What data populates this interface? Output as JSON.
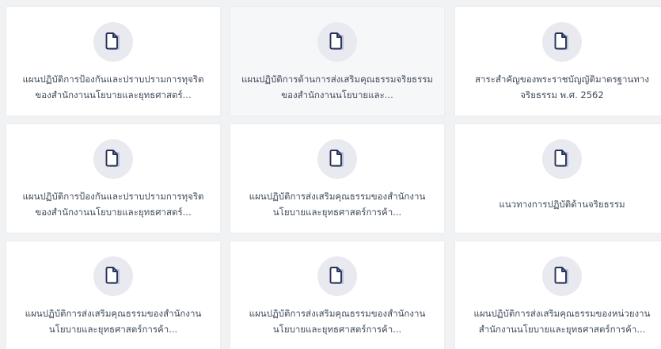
{
  "colors": {
    "icon": "#27325a",
    "icon_shadow": "#b9c1d9",
    "icon_bg": "#e8eaef",
    "text": "#3f4a5a",
    "page_bg": "#f1f2f4"
  },
  "documents": [
    {
      "icon": "document-icon",
      "title": "แผนปฏิบัติการป้องกันและปราบปรามการทุจริตของสำนักงานนโยบายและยุทธศาสตร์..."
    },
    {
      "icon": "document-icon",
      "title": "แผนปฏิบัติการด้านการส่งเสริมคุณธรรมจริยธรรมของสำนักงานนโยบายและ..."
    },
    {
      "icon": "document-icon",
      "title": "สาระสำคัญของพระราชบัญญัติมาตรฐานทางจริยธรรม พ.ศ. 2562"
    },
    {
      "icon": "document-icon",
      "title": "แผนปฏิบัติการป้องกันและปราบปรามการทุจริตของสำนักงานนโยบายและยุทธศาสตร์..."
    },
    {
      "icon": "document-icon",
      "title": "แผนปฏิบัติการส่งเสริมคุณธรรมของสำนักงานนโยบายและยุทธศาสตร์การค้า..."
    },
    {
      "icon": "document-icon",
      "title": "แนวทางการปฏิบัติด้านจริยธรรม"
    },
    {
      "icon": "document-icon",
      "title": "แผนปฏิบัติการส่งเสริมคุณธรรมของสำนักงานนโยบายและยุทธศาสตร์การค้า..."
    },
    {
      "icon": "document-icon",
      "title": "แผนปฏิบัติการส่งเสริมคุณธรรมของสำนักงานนโยบายและยุทธศาสตร์การค้า..."
    },
    {
      "icon": "document-icon",
      "title": "แผนปฏิบัติการส่งเสริมคุณธรรมของหน่วยงาน สำนักงานนโยบายและยุทธศาสตร์การค้า..."
    }
  ]
}
